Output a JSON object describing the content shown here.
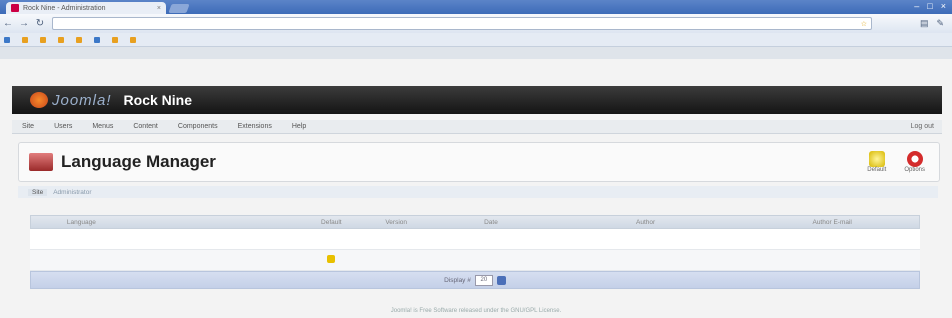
{
  "browser": {
    "tab_title": "Rock Nine - Administration",
    "url": "",
    "bookmarks": [
      "",
      "",
      "",
      "",
      "",
      "",
      "",
      "",
      "",
      ""
    ]
  },
  "admin_bar": [
    "",
    "",
    "",
    ""
  ],
  "header": {
    "brand": "Joomla!",
    "site_name": "Rock Nine",
    "version": ""
  },
  "menu": {
    "items": [
      "Site",
      "Users",
      "Menus",
      "Content",
      "Components",
      "Extensions",
      "Help"
    ],
    "status": [
      "",
      "",
      "Log out"
    ]
  },
  "toolbar": {
    "title": "Language Manager",
    "buttons": [
      {
        "label": "Default"
      },
      {
        "label": "Options"
      }
    ]
  },
  "submenu": {
    "items": [
      "Site",
      "Administrator"
    ]
  },
  "table": {
    "headers": [
      "",
      "",
      "Language",
      "Default",
      "Version",
      "Date",
      "Author",
      "Author E-mail"
    ],
    "rows": [
      [
        "",
        "",
        "",
        "",
        "",
        "",
        "",
        ""
      ],
      [
        "",
        "",
        "",
        "",
        "",
        "",
        "",
        ""
      ]
    ],
    "pagination": {
      "label": "Display #",
      "value": "20"
    }
  },
  "footer": {
    "text": "Joomla! is Free Software released under the GNU/GPL License."
  }
}
